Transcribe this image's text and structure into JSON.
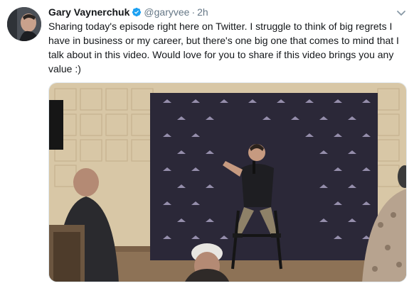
{
  "tweet": {
    "author_name": "Gary Vaynerchuk",
    "handle": "@garyvee",
    "separator": "·",
    "time": "2h",
    "text": "Sharing today's episode right here on Twitter. I struggle to think of big regrets I have in business or my career, but there's one big one that comes to mind that I talk about in this video. Would love for you to share if this video brings you any value :)",
    "icons": {
      "verified": "verified-badge-icon",
      "more": "chevron-down-icon"
    },
    "colors": {
      "verified": "#1da1f2",
      "secondary_text": "#657786",
      "backdrop": "#2b2838"
    }
  }
}
